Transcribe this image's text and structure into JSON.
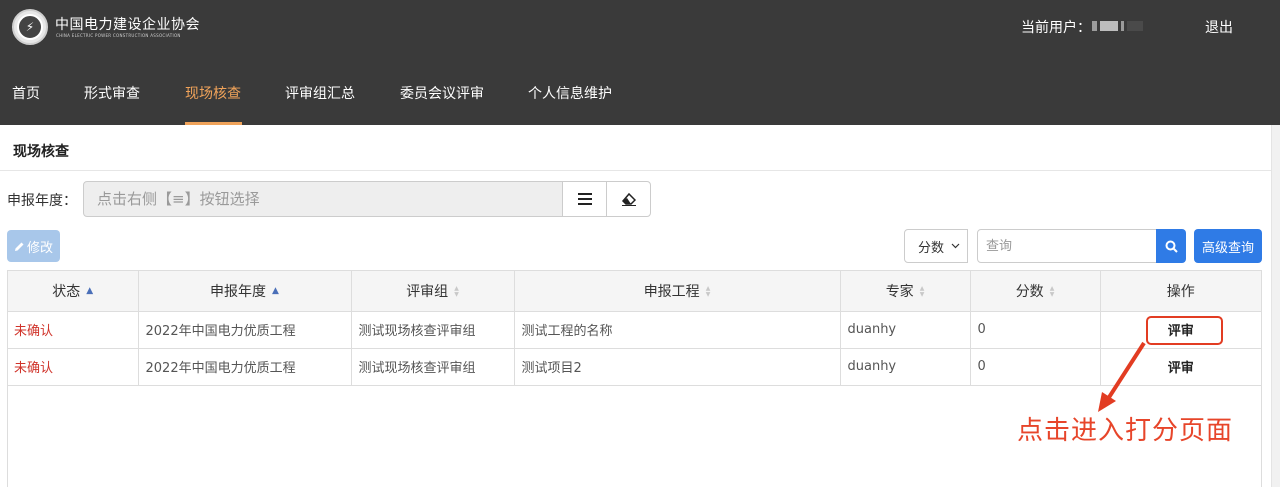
{
  "header": {
    "org_name": "中国电力建设企业协会",
    "org_name_en": "CHINA ELECTRIC POWER CONSTRUCTION ASSOCIATION",
    "logo_text": "⚡",
    "user_label": "当前用户：",
    "logout": "退出"
  },
  "nav": {
    "items": [
      {
        "label": "首页"
      },
      {
        "label": "形式审查"
      },
      {
        "label": "现场核查",
        "active": true
      },
      {
        "label": "评审组汇总"
      },
      {
        "label": "委员会议评审"
      },
      {
        "label": "个人信息维护"
      }
    ]
  },
  "page": {
    "title": "现场核查"
  },
  "filter": {
    "label": "申报年度：",
    "placeholder": "点击右侧【≡】按钮选择",
    "list_icon": "list-icon",
    "clear_icon": "eraser-icon"
  },
  "toolbar": {
    "edit_label": "修改",
    "field_select": "分数",
    "search_placeholder": "查询",
    "advanced_label": "高级查询"
  },
  "table": {
    "columns": [
      "状态",
      "申报年度",
      "评审组",
      "申报工程",
      "专家",
      "分数",
      "操作"
    ],
    "rows": [
      {
        "status": "未确认",
        "year": "2022年中国电力优质工程",
        "group": "测试现场核查评审组",
        "project": "测试工程的名称",
        "expert": "duanhy",
        "score": "0",
        "action": "评审"
      },
      {
        "status": "未确认",
        "year": "2022年中国电力优质工程",
        "group": "测试现场核查评审组",
        "project": "测试项目2",
        "expert": "duanhy",
        "score": "0",
        "action": "评审"
      }
    ]
  },
  "annotation": {
    "text": "点击进入打分页面"
  },
  "colors": {
    "header_bg": "#3a3a3a",
    "nav_active": "#f0a35a",
    "primary": "#2f7be6",
    "status_red": "#d0332a",
    "annotation_red": "#e7452a"
  }
}
